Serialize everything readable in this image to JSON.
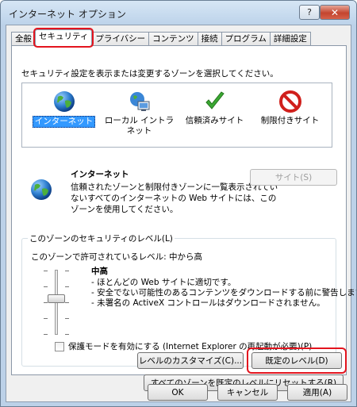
{
  "window": {
    "title": "インターネット オプション",
    "help_label": "?",
    "close_label": "✕"
  },
  "tabs": [
    {
      "label": "全般"
    },
    {
      "label": "セキュリティ",
      "active": true
    },
    {
      "label": "プライバシー"
    },
    {
      "label": "コンテンツ"
    },
    {
      "label": "接続"
    },
    {
      "label": "プログラム"
    },
    {
      "label": "詳細設定"
    }
  ],
  "prompt": "セキュリティ設定を表示または変更するゾーンを選択してください。",
  "zones": [
    {
      "label": "インターネット",
      "icon": "globe-icon",
      "selected": true
    },
    {
      "label": "ローカル イントラネット",
      "icon": "local-intranet-icon"
    },
    {
      "label": "信頼済みサイト",
      "icon": "checkmark-icon"
    },
    {
      "label": "制限付きサイト",
      "icon": "restricted-icon"
    }
  ],
  "zone_detail": {
    "title": "インターネット",
    "description": "信頼されたゾーンと制限付きゾーンに一覧表示されていないすべてのインターネットの Web サイトには、このゾーンを使用してください。",
    "sites_button": "サイト(S)"
  },
  "security_level": {
    "group_label": "このゾーンのセキュリティのレベル(L)",
    "allowed_text": "このゾーンで許可されているレベル: 中から高",
    "level_name": "中高",
    "bullets": [
      "- ほとんどの Web サイトに適切です。",
      "- 安全でない可能性のあるコンテンツをダウンロードする前に警告します。",
      "- 未署名の ActiveX コントロールはダウンロードされません。"
    ],
    "slider_level": "中高"
  },
  "protected_mode": {
    "label": "保護モードを有効にする (Internet Explorer の再起動が必要)(P)",
    "checked": false
  },
  "buttons": {
    "custom": "レベルのカスタマイズ(C)...",
    "default": "既定のレベル(D)",
    "reset_all": "すべてのゾーンを既定のレベルにリセットする(R)",
    "ok": "OK",
    "cancel": "キャンセル",
    "apply": "適用(A)"
  },
  "colors": {
    "highlight": "#e3141e",
    "selection": "#3399ff"
  }
}
